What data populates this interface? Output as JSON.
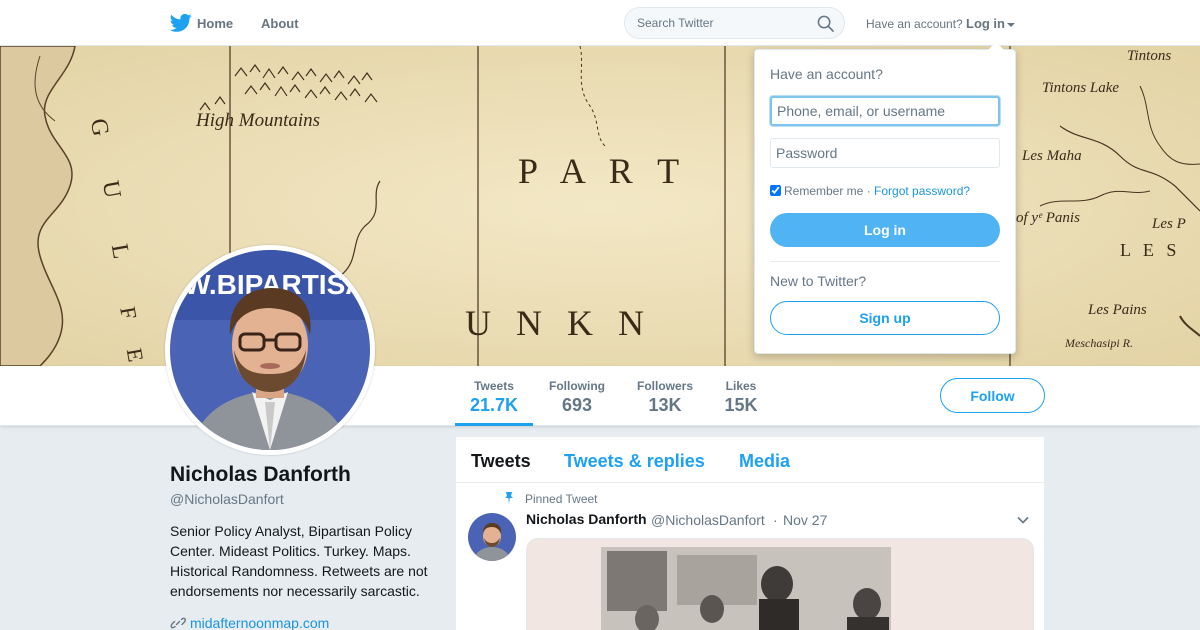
{
  "nav": {
    "home_label": "Home",
    "about_label": "About",
    "search_placeholder": "Search Twitter",
    "have_account_text": "Have an account?",
    "login_label": "Log in",
    "icons": {
      "logo": "twitter-bird-icon",
      "search": "search-icon",
      "caret": "caret-down-icon"
    }
  },
  "banner": {
    "map_labels": [
      "High Mountains",
      "P A R T",
      "U N K N",
      "Tintons",
      "Tintons Lake",
      "Les Maha",
      "of yᵉ Panis",
      "Les P",
      "L E S",
      "Les Pains",
      "Meschasipi R.",
      "G",
      "U",
      "L",
      "F",
      "E"
    ]
  },
  "profile": {
    "name": "Nicholas Danforth",
    "handle": "@NicholasDanfort",
    "bio": "Senior Policy Analyst, Bipartisan Policy Center. Mideast Politics. Turkey. Maps. Historical Randomness. Retweets are not endorsements nor necessarily sarcastic.",
    "website": "midafternoonmap.com",
    "avatar_backdrop_text": "W.BIPARTISA"
  },
  "stats": [
    {
      "label": "Tweets",
      "value": "21.7K"
    },
    {
      "label": "Following",
      "value": "693"
    },
    {
      "label": "Followers",
      "value": "13K"
    },
    {
      "label": "Likes",
      "value": "15K"
    }
  ],
  "follow_label": "Follow",
  "timeline": {
    "tabs": [
      "Tweets",
      "Tweets & replies",
      "Media"
    ],
    "pinned_label": "Pinned Tweet",
    "tweet": {
      "author": "Nicholas Danforth",
      "handle": "@NicholasDanfort",
      "separator": "·",
      "date": "Nov 27"
    }
  },
  "login_dropdown": {
    "title": "Have an account?",
    "username_placeholder": "Phone, email, or username",
    "password_placeholder": "Password",
    "remember_label": "Remember me",
    "separator": " · ",
    "forgot_label": "Forgot password?",
    "login_button": "Log in",
    "new_to_text": "New to Twitter?",
    "signup_button": "Sign up"
  },
  "colors": {
    "accent": "#1da1f2",
    "login_button": "#4fb3f4",
    "background": "#e6ecf0"
  }
}
